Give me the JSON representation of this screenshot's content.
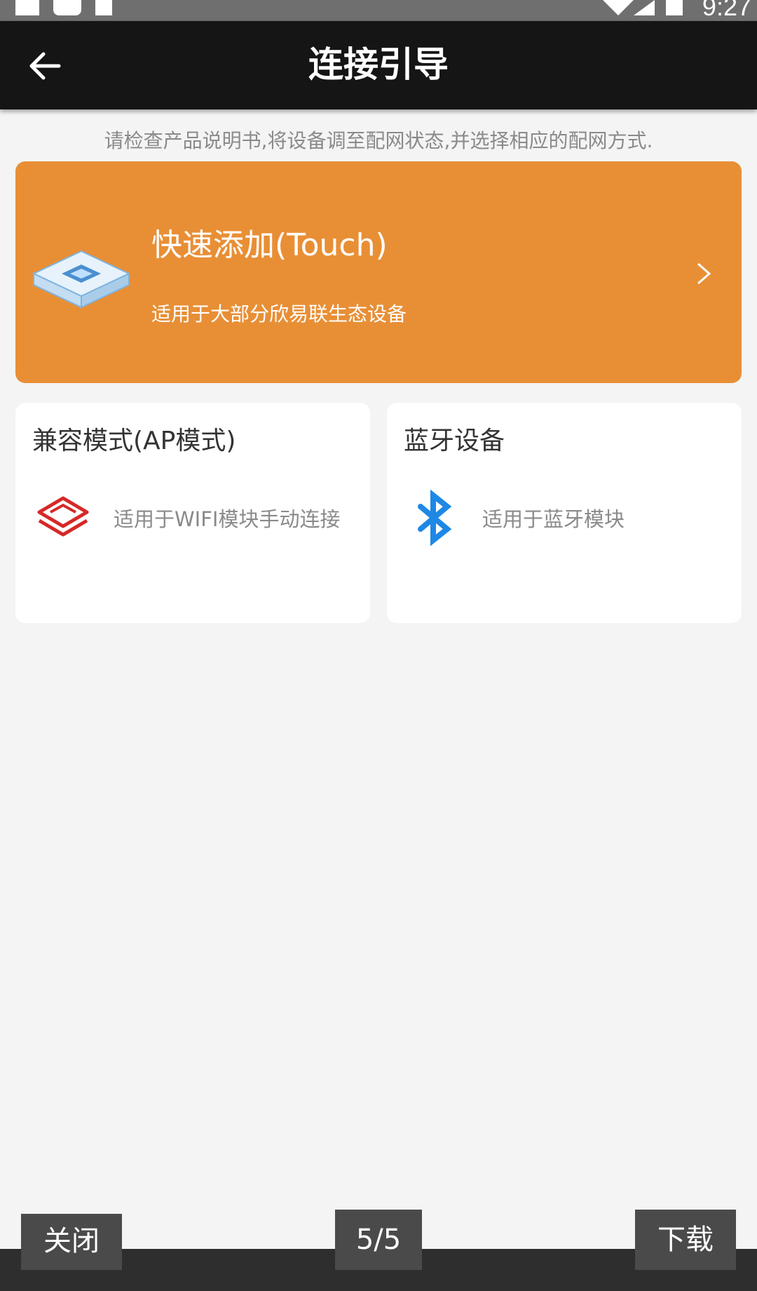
{
  "statusbar": {
    "time": "9:27"
  },
  "appbar": {
    "title": "连接引导"
  },
  "hint": "请检查产品说明书,将设备调至配网状态,并选择相应的配网方式.",
  "quick_add": {
    "title": "快速添加(Touch)",
    "subtitle": "适用于大部分欣易联生态设备",
    "icon": "chip-device-icon"
  },
  "modes": [
    {
      "title": "兼容模式(AP模式)",
      "desc": "适用于WIFI模块手动连接",
      "icon": "layers-icon",
      "icon_color": "#d62828"
    },
    {
      "title": "蓝牙设备",
      "desc": "适用于蓝牙模块",
      "icon": "bluetooth-icon",
      "icon_color": "#1e88e5"
    }
  ],
  "viewer": {
    "close_label": "关闭",
    "page_indicator": "5/5",
    "download_label": "下载"
  },
  "colors": {
    "accent": "#e88f36",
    "appbar": "#151515",
    "background": "#f4f4f4"
  }
}
